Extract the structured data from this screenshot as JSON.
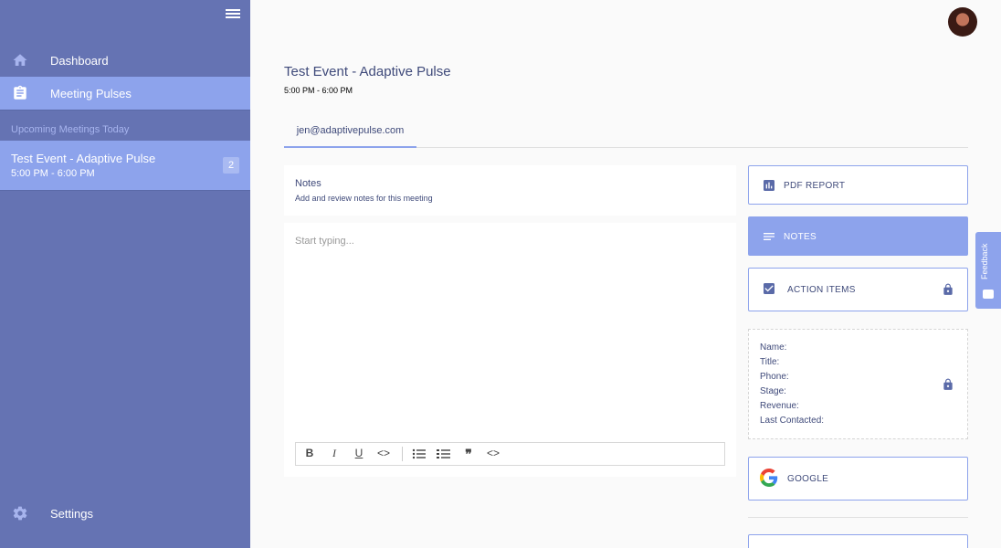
{
  "sidebar": {
    "nav": {
      "dashboard": "Dashboard",
      "meeting_pulses": "Meeting Pulses",
      "settings": "Settings"
    },
    "upcoming_title": "Upcoming Meetings Today",
    "meeting": {
      "title": "Test Event - Adaptive Pulse",
      "time": "5:00 PM - 6:00 PM",
      "badge": "2"
    }
  },
  "main": {
    "title": "Test Event - Adaptive Pulse",
    "time": "5:00 PM - 6:00 PM",
    "tabs": [
      {
        "label": "jen@adaptivepulse.com"
      }
    ],
    "notes": {
      "title": "Notes",
      "subtitle": "Add and review notes for this meeting",
      "placeholder": "Start typing..."
    }
  },
  "panel": {
    "pdf_report": "PDF REPORT",
    "notes": "NOTES",
    "action_items": "ACTION ITEMS",
    "contact": {
      "name": "Name:",
      "title": "Title:",
      "phone": "Phone:",
      "stage": "Stage:",
      "revenue": "Revenue:",
      "last_contacted": "Last Contacted:"
    },
    "google": "GOOGLE"
  },
  "feedback": "Feedback",
  "colors": {
    "sidebar": "#6573b3",
    "accent": "#8da3ec",
    "text": "#3f4a7a"
  }
}
